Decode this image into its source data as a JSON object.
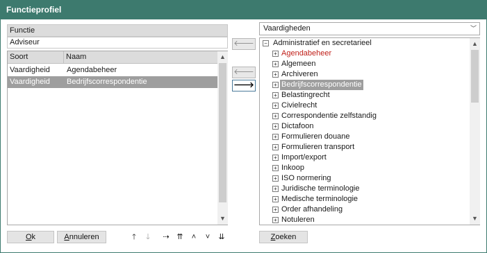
{
  "window": {
    "title": "Functieprofiel"
  },
  "left": {
    "functie_label": "Functie",
    "functie_value": "Adviseur",
    "columns": [
      "Soort",
      "Naam"
    ],
    "rows": [
      {
        "soort": "Vaardigheid",
        "naam": "Agendabeheer",
        "selected": false
      },
      {
        "soort": "Vaardigheid",
        "naam": "Bedrijfscorrespondentie",
        "selected": true
      }
    ]
  },
  "middle": {
    "btn_top": "🡐",
    "btn_left": "🡐",
    "btn_right": "🡒"
  },
  "right": {
    "dropdown_value": "Vaardigheden",
    "tree": {
      "root": "Administratief en secretarieel",
      "root_expander": "−",
      "child_expander": "+",
      "children": [
        {
          "label": "Agendabeheer",
          "style": "red"
        },
        {
          "label": "Algemeen",
          "style": ""
        },
        {
          "label": "Archiveren",
          "style": ""
        },
        {
          "label": "Bedrijfscorrespondentie",
          "style": "sel"
        },
        {
          "label": "Belastingrecht",
          "style": ""
        },
        {
          "label": "Civielrecht",
          "style": ""
        },
        {
          "label": "Correspondentie zelfstandig",
          "style": ""
        },
        {
          "label": "Dictafoon",
          "style": ""
        },
        {
          "label": "Formulieren douane",
          "style": ""
        },
        {
          "label": "Formulieren transport",
          "style": ""
        },
        {
          "label": "Import/export",
          "style": ""
        },
        {
          "label": "Inkoop",
          "style": ""
        },
        {
          "label": "ISO normering",
          "style": ""
        },
        {
          "label": "Juridische terminologie",
          "style": ""
        },
        {
          "label": "Medische terminologie",
          "style": ""
        },
        {
          "label": "Order afhandeling",
          "style": ""
        },
        {
          "label": "Notuleren",
          "style": ""
        }
      ]
    }
  },
  "bottom": {
    "ok_label_u": "O",
    "ok_label_rest": "k",
    "annuleren_u": "A",
    "annuleren_rest": "nnuleren",
    "zoeken_u": "Z",
    "zoeken_rest": "oeken",
    "tools": {
      "up": "🡑",
      "down": "🡓",
      "copy": "⇢",
      "first": "⇈",
      "prev": "˄",
      "next": "˅",
      "last": "⇊"
    }
  }
}
